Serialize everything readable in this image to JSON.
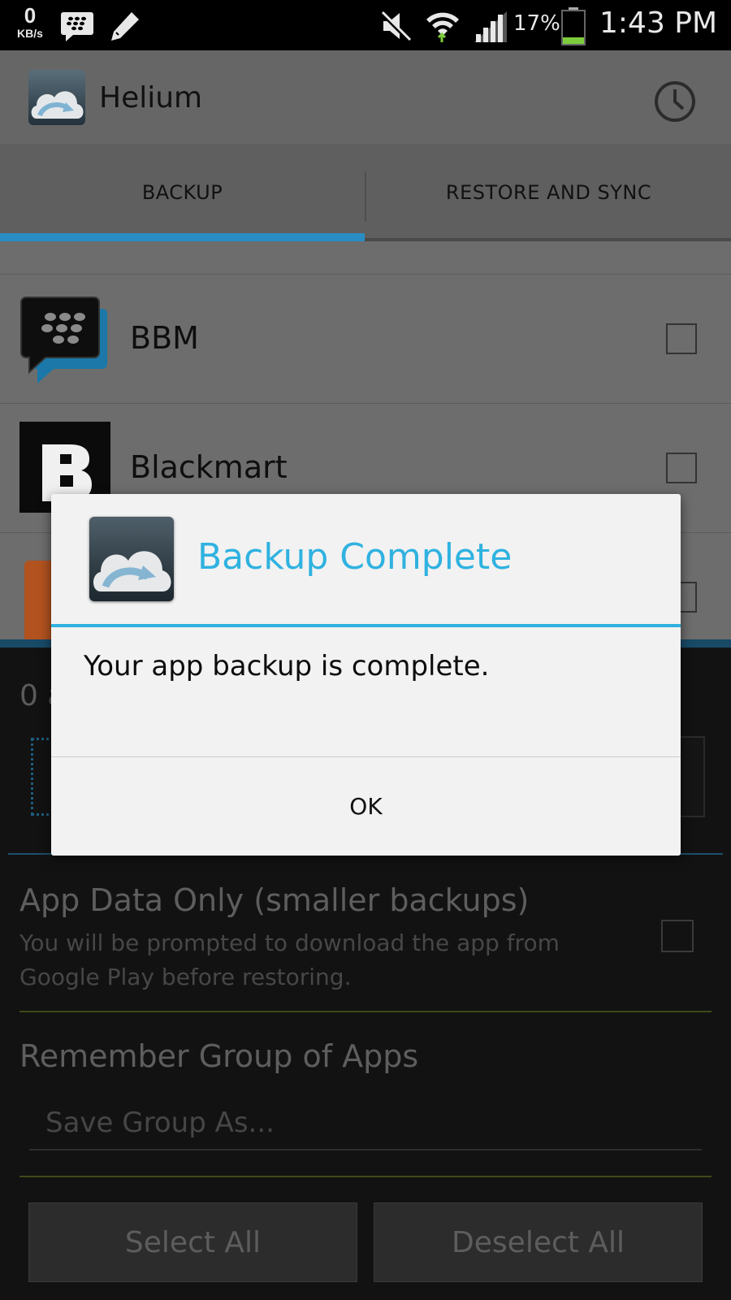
{
  "status_bar": {
    "speed_value": "0",
    "speed_unit": "KB/s",
    "battery_percent": "17%",
    "time": "1:43 PM",
    "icons": [
      "bbm-notification-icon",
      "pencil-icon",
      "mute-icon",
      "wifi-icon",
      "signal-icon",
      "battery-icon"
    ]
  },
  "app": {
    "title": "Helium",
    "icons": [
      "helium-cloud-icon",
      "history-clock-icon"
    ]
  },
  "tabs": [
    {
      "label": "BACKUP",
      "selected": true
    },
    {
      "label": "RESTORE AND SYNC",
      "selected": false
    }
  ],
  "apps": [
    {
      "name": "BBM",
      "checked": false
    },
    {
      "name": "Blackmart",
      "checked": false
    }
  ],
  "options": {
    "count_text": "0 a",
    "app_data_only_title": "App Data Only (smaller backups)",
    "app_data_only_desc": "You will be prompted to download the app from Google Play before restoring.",
    "app_data_only_checked": false,
    "group_title": "Remember Group of Apps",
    "group_placeholder": "Save Group As...",
    "select_all": "Select All",
    "deselect_all": "Deselect All"
  },
  "dialog": {
    "title": "Backup Complete",
    "message": "Your app backup is complete.",
    "ok_label": "OK"
  },
  "colors": {
    "accent": "#2fb2e0",
    "tab_indicator": "#2a8cc4",
    "battery_green": "#7ccc3c"
  }
}
